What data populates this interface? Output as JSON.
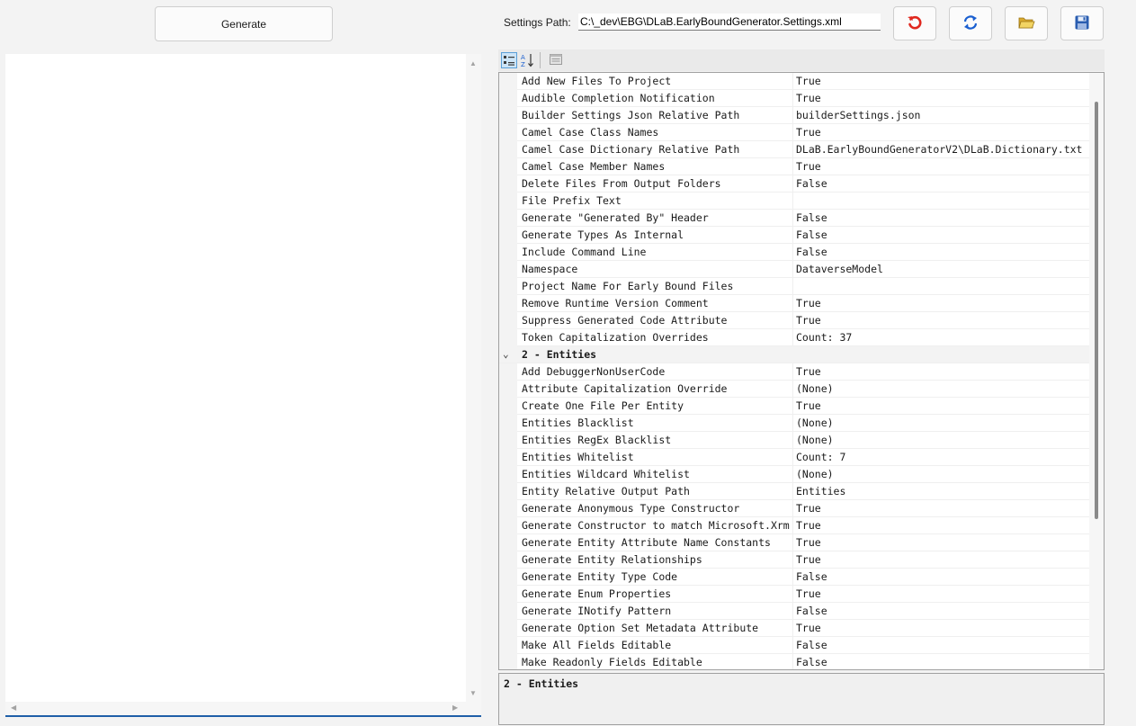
{
  "toolbar": {
    "generate_label": "Generate",
    "settings_path_label": "Settings Path:",
    "settings_path_value": "C:\\_dev\\EBG\\DLaB.EarlyBoundGenerator.Settings.xml",
    "icons": [
      "undo-icon",
      "refresh-icon",
      "folder-open-icon",
      "save-icon"
    ]
  },
  "colors": {
    "accent": "#1f5fa8",
    "undo": "#e0281f",
    "refresh": "#1a5fd0",
    "folder": "#e8c54a",
    "save": "#2a5db0"
  },
  "property_grid": {
    "rows": [
      {
        "name": "Add New Files To Project",
        "value": "True"
      },
      {
        "name": "Audible Completion Notification",
        "value": "True"
      },
      {
        "name": "Builder Settings Json Relative Path",
        "value": "builderSettings.json"
      },
      {
        "name": "Camel Case Class Names",
        "value": "True"
      },
      {
        "name": "Camel Case Dictionary Relative Path",
        "value": "DLaB.EarlyBoundGeneratorV2\\DLaB.Dictionary.txt"
      },
      {
        "name": "Camel Case Member Names",
        "value": "True"
      },
      {
        "name": "Delete Files From Output Folders",
        "value": "False"
      },
      {
        "name": "File Prefix Text",
        "value": ""
      },
      {
        "name": "Generate \"Generated By\" Header",
        "value": "False"
      },
      {
        "name": "Generate Types As Internal",
        "value": "False"
      },
      {
        "name": "Include Command Line",
        "value": "False"
      },
      {
        "name": "Namespace",
        "value": "DataverseModel"
      },
      {
        "name": "Project Name For Early Bound Files",
        "value": ""
      },
      {
        "name": "Remove Runtime Version Comment",
        "value": "True"
      },
      {
        "name": "Suppress Generated Code Attribute",
        "value": "True"
      },
      {
        "name": "Token Capitalization Overrides",
        "value": "Count: 37"
      },
      {
        "category": true,
        "name": "2 - Entities"
      },
      {
        "name": "Add DebuggerNonUserCode",
        "value": "True"
      },
      {
        "name": "Attribute Capitalization Override",
        "value": "(None)"
      },
      {
        "name": "Create One File Per Entity",
        "value": "True"
      },
      {
        "name": "Entities Blacklist",
        "value": "(None)"
      },
      {
        "name": "Entities RegEx Blacklist",
        "value": "(None)"
      },
      {
        "name": "Entities Whitelist",
        "value": "Count: 7"
      },
      {
        "name": "Entities Wildcard Whitelist",
        "value": "(None)"
      },
      {
        "name": "Entity Relative Output Path",
        "value": "Entities"
      },
      {
        "name": "Generate Anonymous Type Constructor",
        "value": "True"
      },
      {
        "name": "Generate Constructor to match Microsoft.Xrm",
        "value": "True"
      },
      {
        "name": "Generate Entity Attribute Name Constants",
        "value": "True"
      },
      {
        "name": "Generate Entity Relationships",
        "value": "True"
      },
      {
        "name": "Generate Entity Type Code",
        "value": "False"
      },
      {
        "name": "Generate Enum Properties",
        "value": "True"
      },
      {
        "name": "Generate INotify Pattern",
        "value": "False"
      },
      {
        "name": "Generate Option Set Metadata Attribute",
        "value": "True"
      },
      {
        "name": "Make All Fields Editable",
        "value": "False"
      },
      {
        "name": "Make Readonly Fields Editable",
        "value": "False"
      }
    ],
    "description_title": "2 - Entities"
  }
}
